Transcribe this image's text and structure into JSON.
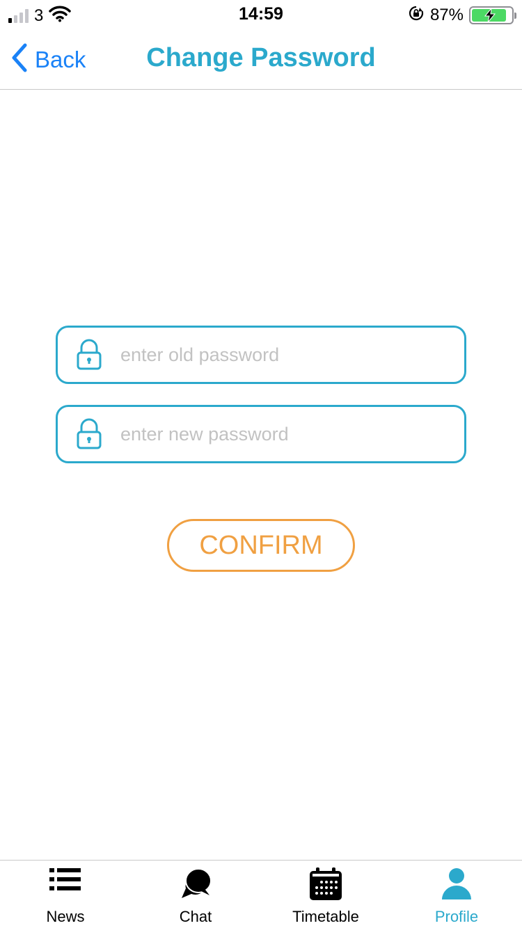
{
  "status_bar": {
    "carrier": "3",
    "time": "14:59",
    "battery_percent": "87%",
    "signal_bars_on": 1,
    "battery_level": 0.87
  },
  "nav": {
    "back_label": "Back",
    "title": "Change Password"
  },
  "form": {
    "old_password_placeholder": "enter old password",
    "old_password_value": "",
    "new_password_placeholder": "enter new password",
    "new_password_value": "",
    "confirm_label": "CONFIRM"
  },
  "tabs": [
    {
      "label": "News",
      "icon": "list-icon",
      "active": false
    },
    {
      "label": "Chat",
      "icon": "chat-bubbles-icon",
      "active": false
    },
    {
      "label": "Timetable",
      "icon": "calendar-icon",
      "active": false
    },
    {
      "label": "Profile",
      "icon": "person-icon",
      "active": true
    }
  ],
  "colors": {
    "accent": "#2ba9cc",
    "back_link": "#1a82f7",
    "confirm": "#f0a042",
    "battery_fill": "#4cd964"
  }
}
